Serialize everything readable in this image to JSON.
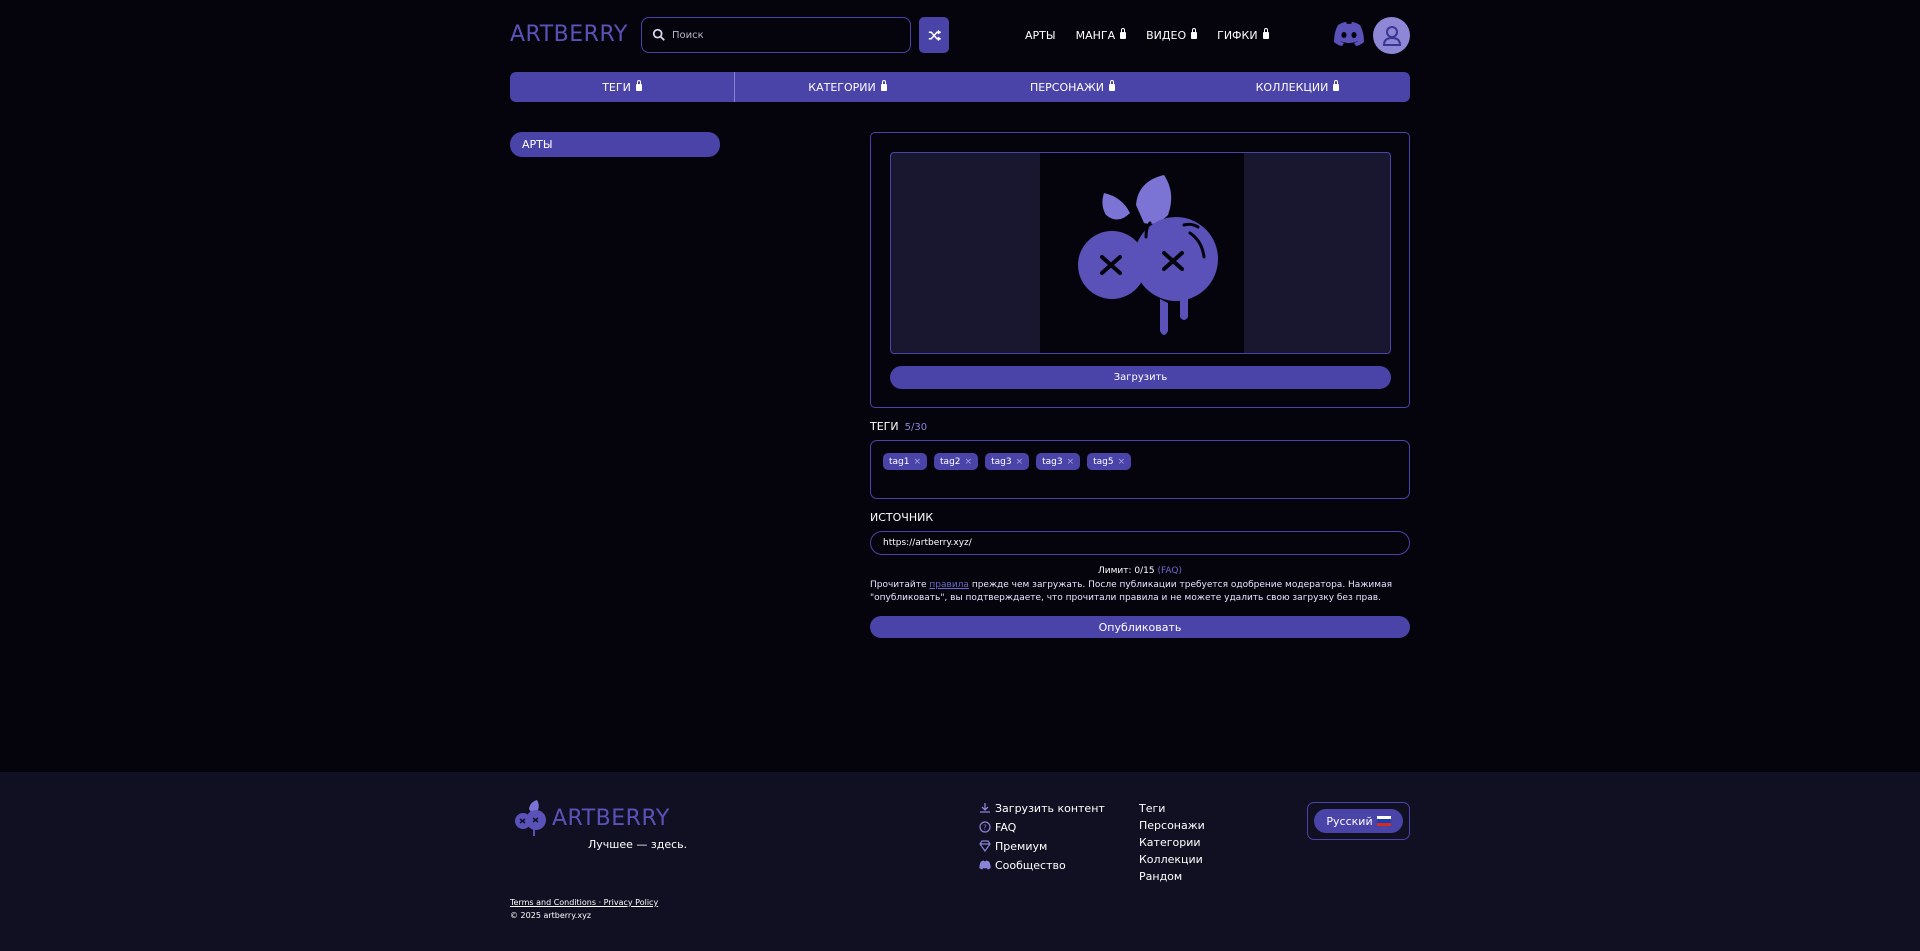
{
  "header": {
    "logo": "ARTBERRY",
    "search_placeholder": "Поиск",
    "nav": [
      {
        "label": "АРТЫ"
      },
      {
        "label": "МАНГА"
      },
      {
        "label": "ВИДЕО"
      },
      {
        "label": "ГИФКИ"
      }
    ]
  },
  "catbar": [
    "ТЕГИ",
    "КАТЕГОРИИ",
    "ПЕРСОНАЖИ",
    "КОЛЛЕКЦИИ"
  ],
  "sidebar": {
    "active": "АРТЫ"
  },
  "upload": {
    "button": "Загрузить"
  },
  "tags": {
    "title": "ТЕГИ",
    "count": "5/30",
    "items": [
      "tag1",
      "tag2",
      "tag3",
      "tag3",
      "tag5"
    ],
    "remove": "×"
  },
  "source": {
    "title": "ИСТОЧНИК",
    "value": "https://artberry.xyz/"
  },
  "limit": {
    "text": "Лимит: 0/15",
    "faq": "(FAQ)"
  },
  "notice": {
    "before": "Прочитайте ",
    "link": "правила",
    "after": " прежде чем загружать. После публикации требуется одобрение модератора. Нажимая \"опубликовать\", вы подтверждаете, что прочитали правила и не можете удалить свою загрузку без прав."
  },
  "publish": "Опубликовать",
  "footer": {
    "logo": "ARTBERRY",
    "tagline": "Лучшее — здесь.",
    "links1": [
      "Загрузить контент",
      "FAQ",
      "Премиум",
      "Сообщество"
    ],
    "links2": [
      "Теги",
      "Персонажи",
      "Категории",
      "Коллекции",
      "Рандом"
    ],
    "language": "Русский",
    "terms": "Terms and Conditions · Privacy Policy",
    "copyright": "© 2025 artberry.xyz"
  },
  "colors": {
    "accent": "#4a43a8",
    "bg": "#05040c",
    "footer_bg": "#111022"
  }
}
